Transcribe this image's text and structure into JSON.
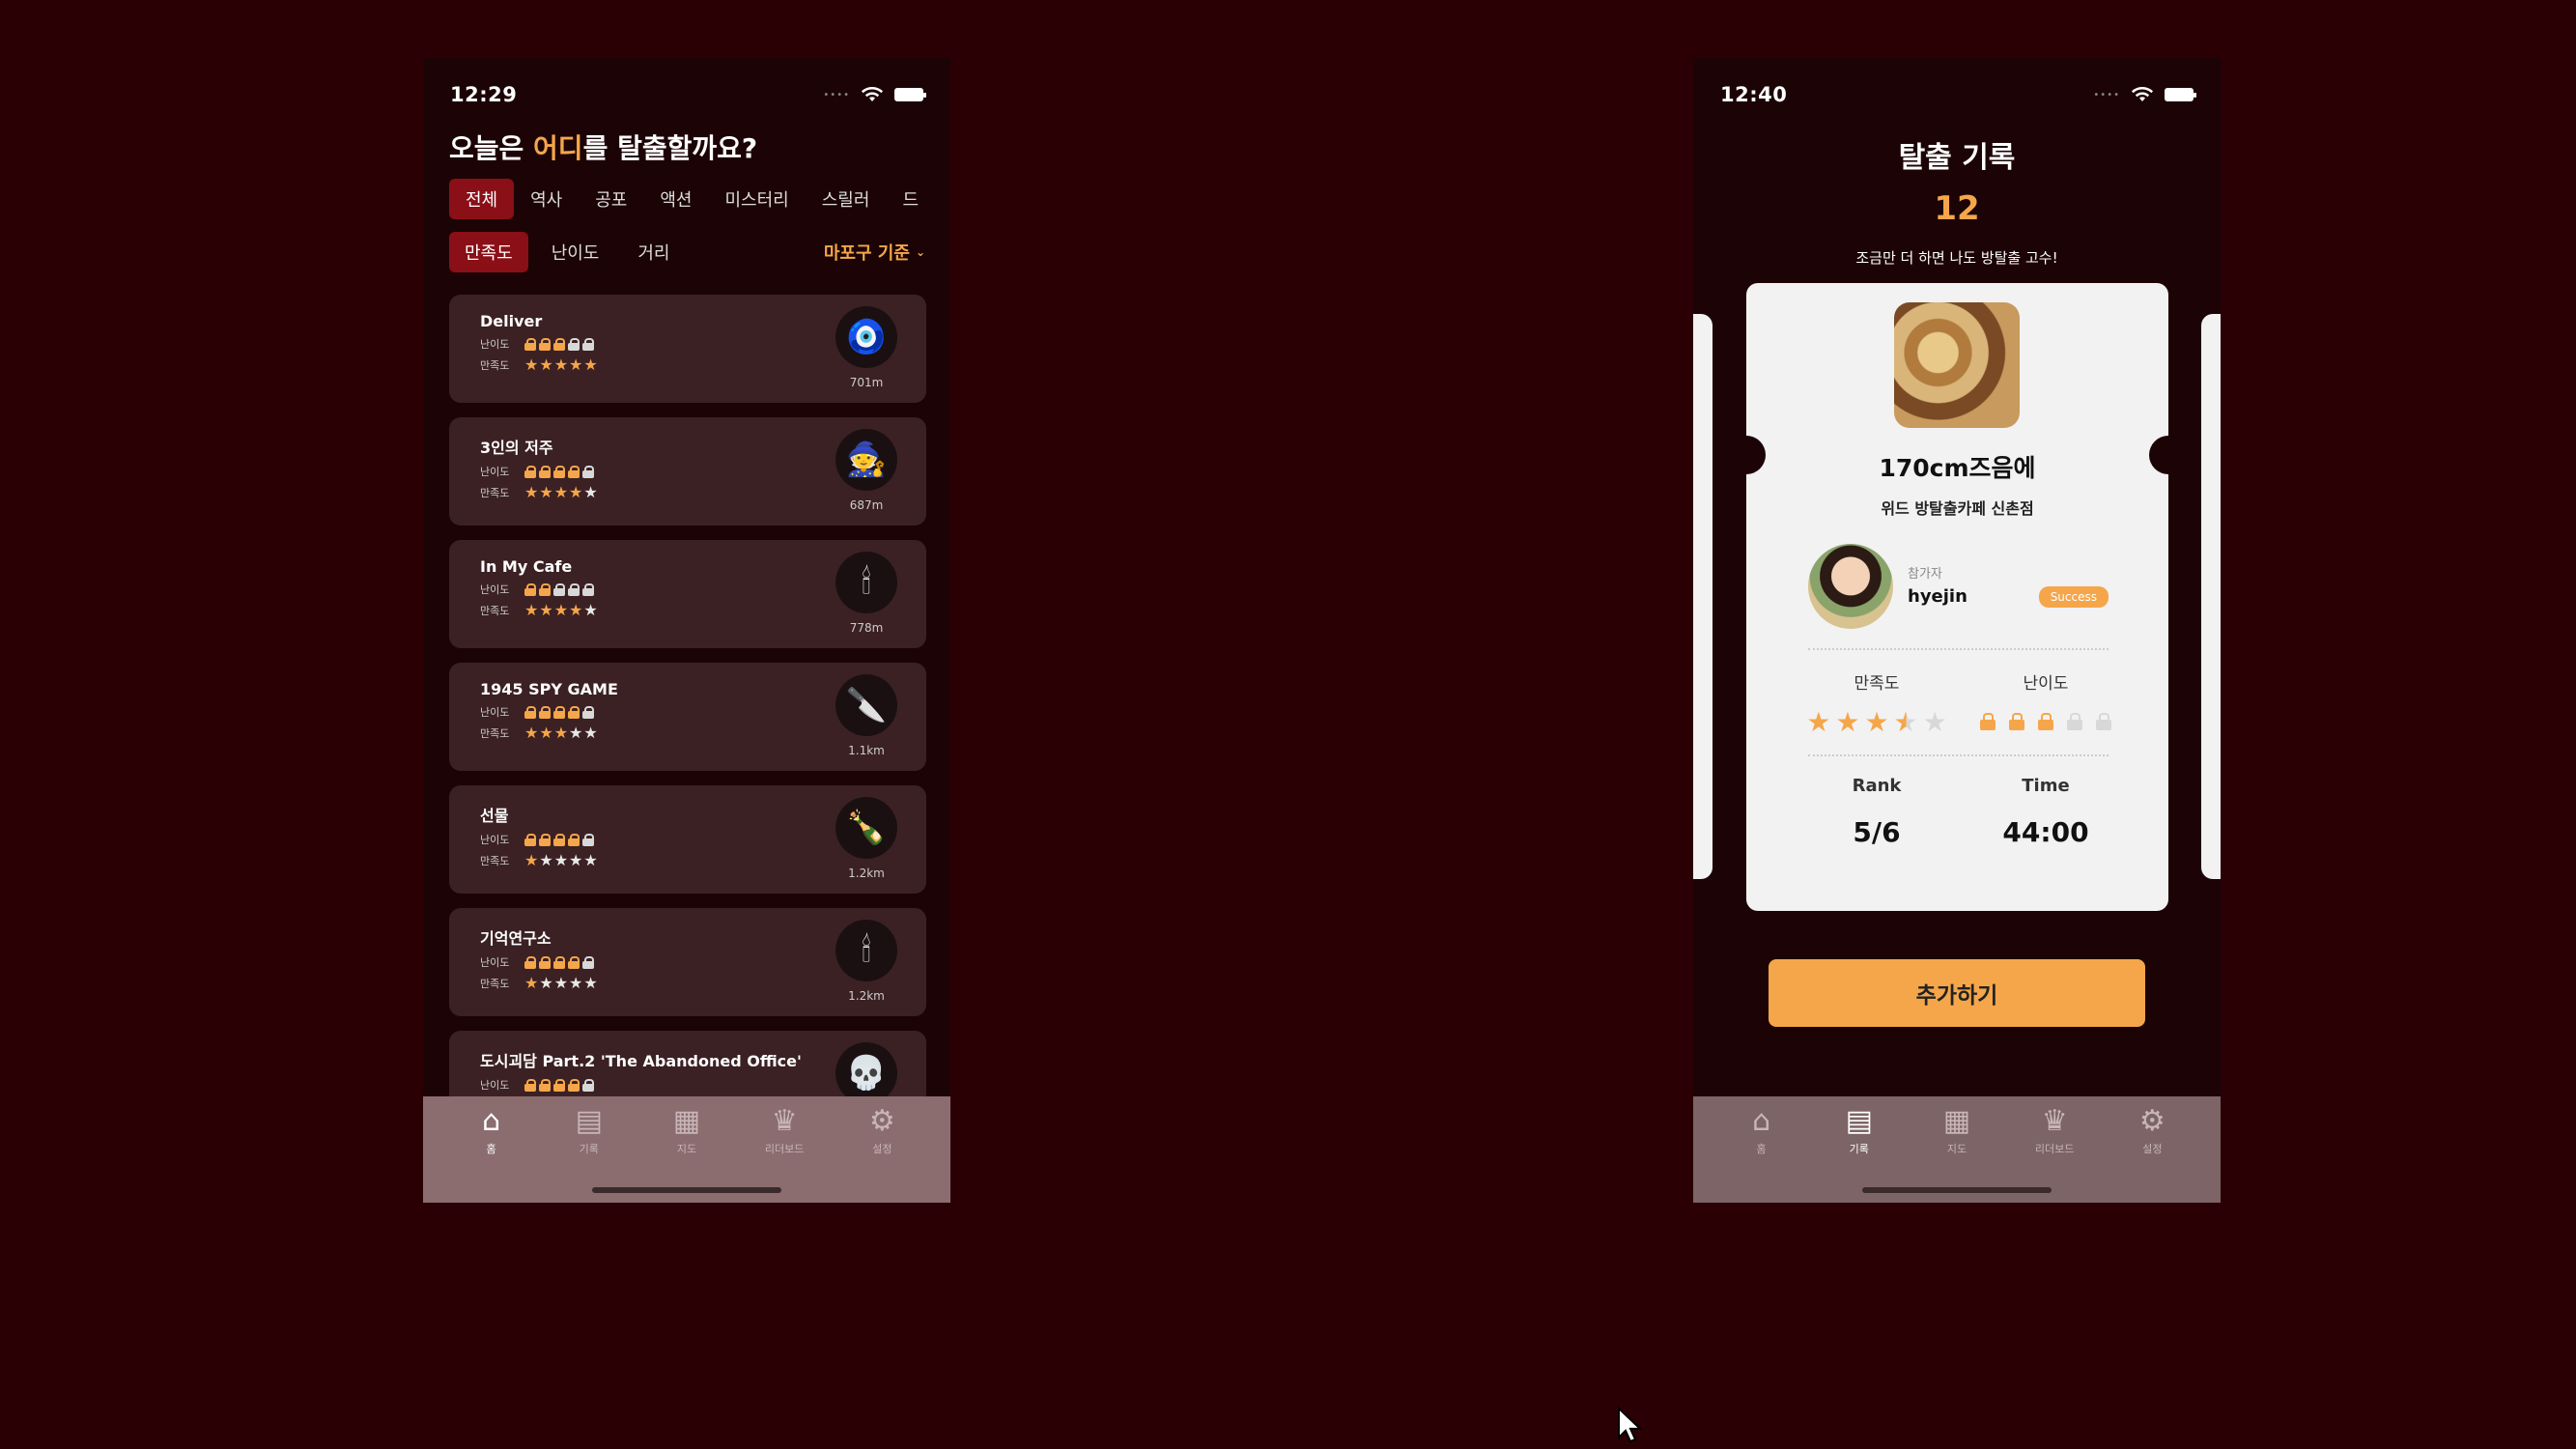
{
  "left_screen": {
    "status_time": "12:29",
    "title_prefix": "오늘은 ",
    "title_highlight": "어디",
    "title_suffix": "를 탈출할까요?",
    "genres": [
      "전체",
      "역사",
      "공포",
      "액션",
      "미스터리",
      "스릴러",
      "드"
    ],
    "sorts": [
      "만족도",
      "난이도",
      "거리"
    ],
    "location": "마포구  기준",
    "difficulty_label": "난이도",
    "satisfaction_label": "만족도",
    "rooms": [
      {
        "name": "Deliver",
        "difficulty": 3,
        "satisfaction": 5,
        "distance": "701m",
        "icon": "🧿"
      },
      {
        "name": "3인의 저주",
        "difficulty": 4,
        "satisfaction": 4,
        "distance": "687m",
        "icon": "🧙"
      },
      {
        "name": "In My Cafe",
        "difficulty": 2,
        "satisfaction": 4,
        "distance": "778m",
        "icon": "🕯"
      },
      {
        "name": "1945 SPY GAME",
        "difficulty": 4,
        "satisfaction": 3,
        "distance": "1.1km",
        "icon": "🔪"
      },
      {
        "name": "선물",
        "difficulty": 4,
        "satisfaction": 1,
        "distance": "1.2km",
        "icon": "🍾"
      },
      {
        "name": "기억연구소",
        "difficulty": 4,
        "satisfaction": 1,
        "distance": "1.2km",
        "icon": "🕯"
      },
      {
        "name": "도시괴담 Part.2 'The Abandoned Office'",
        "difficulty": 4,
        "satisfaction": 0,
        "distance": "",
        "icon": "💀"
      }
    ],
    "tabs": [
      {
        "label": "홈",
        "icon": "home-icon",
        "active": true
      },
      {
        "label": "기록",
        "icon": "record-icon",
        "active": false
      },
      {
        "label": "지도",
        "icon": "map-icon",
        "active": false
      },
      {
        "label": "리더보드",
        "icon": "trophy-icon",
        "active": false
      },
      {
        "label": "설정",
        "icon": "gear-icon",
        "active": false
      }
    ]
  },
  "right_screen": {
    "status_time": "12:40",
    "title": "탈출 기록",
    "count": "12",
    "message": "조금만 더 하면 나도 방탈출 고수!",
    "record": {
      "theme_name": "170cm즈음에",
      "store_name": "위드 방탈출카페 신촌점",
      "participant_label": "참가자",
      "participant_name": "hyejin",
      "result_badge": "Success",
      "satisfaction_label": "만족도",
      "difficulty_label": "난이도",
      "satisfaction": 3.5,
      "difficulty": 3,
      "rank_label": "Rank",
      "rank_value": "5/6",
      "time_label": "Time",
      "time_value": "44:00"
    },
    "add_button": "추가하기",
    "tabs": [
      {
        "label": "홈",
        "icon": "home-icon",
        "active": false
      },
      {
        "label": "기록",
        "icon": "record-icon",
        "active": true
      },
      {
        "label": "지도",
        "icon": "map-icon",
        "active": false
      },
      {
        "label": "리더보드",
        "icon": "trophy-icon",
        "active": false
      },
      {
        "label": "설정",
        "icon": "gear-icon",
        "active": false
      }
    ]
  },
  "colors": {
    "background": "#2a0005",
    "accent": "#f5a64a",
    "chip_active": "#8a0f16"
  }
}
